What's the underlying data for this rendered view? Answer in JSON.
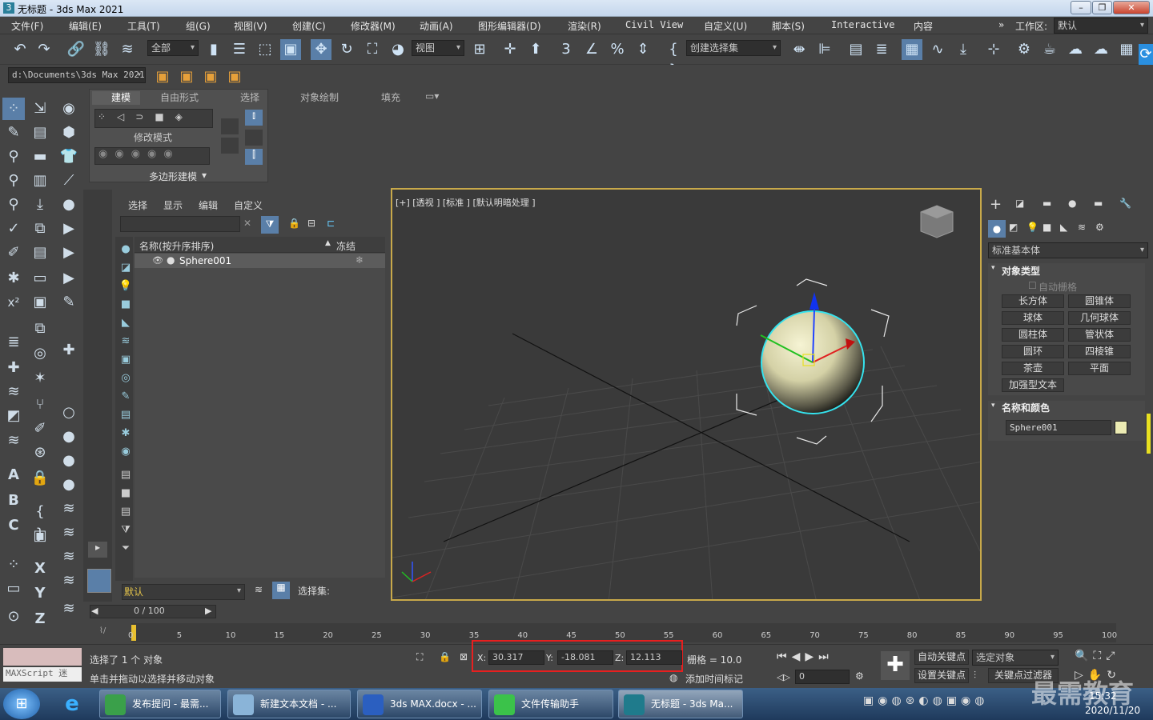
{
  "window": {
    "title": "无标题 - 3ds Max 2021",
    "app_icon": "3"
  },
  "menu": [
    "文件(F)",
    "编辑(E)",
    "工具(T)",
    "组(G)",
    "视图(V)",
    "创建(C)",
    "修改器(M)",
    "动画(A)",
    "图形编辑器(D)",
    "渲染(R)",
    "Civil View",
    "自定义(U)",
    "脚本(S)",
    "Interactive",
    "内容"
  ],
  "workspace": {
    "label": "工作区:",
    "value": "默认"
  },
  "toolbar": {
    "filter": "全部",
    "refcoord": "视图",
    "selset": "创建选择集"
  },
  "project_path": "d:\\Documents\\3ds Max 2021",
  "ribbon": {
    "tabs": [
      "建模",
      "自由形式",
      "选择",
      "对象绘制",
      "填充"
    ],
    "modify_mode": "修改模式",
    "poly_modeling": "多边形建模"
  },
  "scene_explorer": {
    "tabs": [
      "选择",
      "显示",
      "编辑",
      "自定义"
    ],
    "col_name": "名称(按升序排序)",
    "col_freeze": "冻结",
    "rows": [
      {
        "name": "Sphere001"
      }
    ],
    "layer": "默认",
    "selset_label": "选择集:"
  },
  "viewport": {
    "label": "[+] [透视 ] [标准 ] [默认明暗处理 ]"
  },
  "command_panel": {
    "category": "标准基本体",
    "rollout_types": "对象类型",
    "autogrid": "自动栅格",
    "buttons": [
      "长方体",
      "圆锥体",
      "球体",
      "几何球体",
      "圆柱体",
      "管状体",
      "圆环",
      "四棱锥",
      "茶壶",
      "平面",
      "加强型文本"
    ],
    "rollout_name": "名称和颜色",
    "object_name": "Sphere001",
    "object_color": "#ecebb3"
  },
  "timeline": {
    "frame": "0 / 100",
    "ticks": [
      "0",
      "5",
      "10",
      "15",
      "20",
      "25",
      "30",
      "35",
      "40",
      "45",
      "50",
      "55",
      "60",
      "65",
      "70",
      "75",
      "80",
      "85",
      "90",
      "95",
      "100"
    ]
  },
  "status": {
    "maxscript": "MAXScript 迷",
    "selected": "选择了 1 个 对象",
    "hint": "单击并拖动以选择并移动对象",
    "x_label": "X:",
    "x": "30.317",
    "y_label": "Y:",
    "y": "-18.081",
    "z_label": "Z:",
    "z": "12.113",
    "grid": "栅格 = 10.0",
    "add_tag": "添加时间标记",
    "auto_key": "自动关键点",
    "set_key": "设置关键点",
    "sel_obj": "选定对象",
    "key_filter": "关键点过滤器",
    "frame_field": "0"
  },
  "taskbar": {
    "items": [
      "发布提问 - 最需...",
      "新建文本文档 - ...",
      "3ds MAX.docx - ...",
      "文件传输助手",
      "无标题 - 3ds Ma..."
    ],
    "date": "2020/11/20",
    "time": "15:32"
  },
  "watermark": "最需教育"
}
